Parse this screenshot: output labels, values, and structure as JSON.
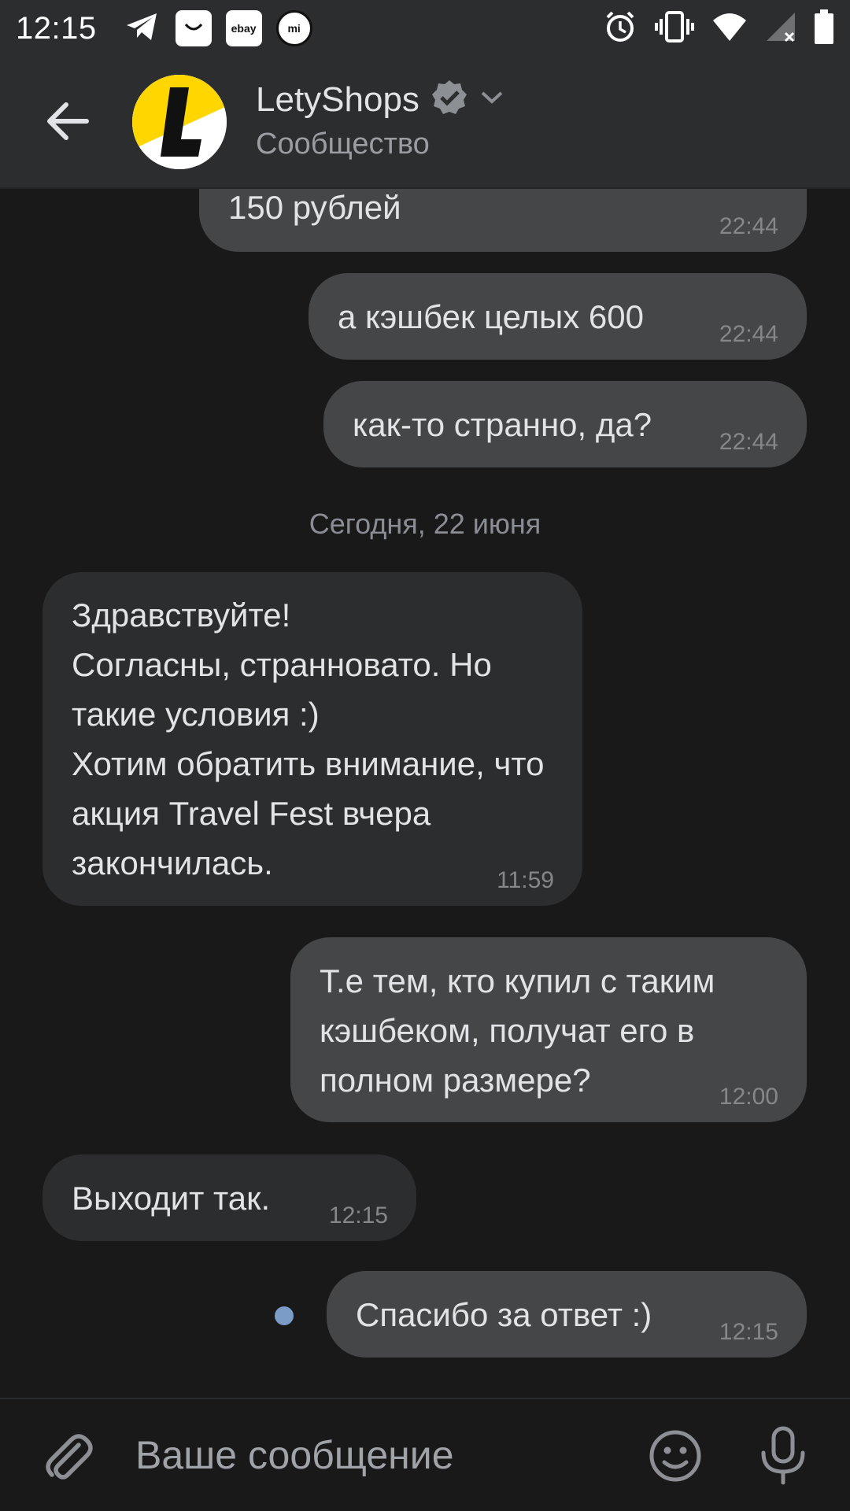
{
  "status_bar": {
    "time": "12:15",
    "notification_icons": [
      "telegram-icon",
      "shopping-bag-icon",
      "ebay-icon",
      "mi-icon"
    ],
    "ebay_label": "ebay",
    "mi_label": "mi",
    "system_icons": [
      "alarm-icon",
      "vibrate-icon",
      "wifi-icon",
      "signal-icon",
      "battery-icon"
    ]
  },
  "header": {
    "title": "LetyShops",
    "subtitle": "Сообщество",
    "verified": true,
    "icons": [
      "back-arrow-icon",
      "verified-badge-icon",
      "chevron-down-icon"
    ]
  },
  "chat": {
    "date_separator": "Сегодня, 22 июня",
    "messages": [
      {
        "direction": "out",
        "text": "150 рублей",
        "time": "22:44"
      },
      {
        "direction": "out",
        "text": "а кэшбек целых 600",
        "time": "22:44"
      },
      {
        "direction": "out",
        "text": "как-то странно, да?",
        "time": "22:44"
      },
      {
        "direction": "in",
        "text": "Здравствуйте!\nСогласны, странновато. Но такие условия :)\nХотим обратить внимание, что акция Travel Fest вчера закончилась.",
        "time": "11:59"
      },
      {
        "direction": "out",
        "text": "Т.е тем, кто купил с таким кэшбеком, получат его в полном размере?",
        "time": "12:00"
      },
      {
        "direction": "in",
        "text": "Выходит так.",
        "time": "12:15"
      },
      {
        "direction": "out",
        "text": "Спасибо за ответ :)",
        "time": "12:15",
        "unread": true
      }
    ]
  },
  "composer": {
    "placeholder": "Ваше сообщение",
    "icons": [
      "attach-icon",
      "emoji-icon",
      "microphone-icon"
    ]
  },
  "colors": {
    "background": "#19191a",
    "header": "#2c2d2e",
    "outgoing_bubble": "#454647",
    "incoming_bubble": "#2c2d2e",
    "unread_dot": "#7a9cc7",
    "brand_yellow": "#ffd600"
  }
}
